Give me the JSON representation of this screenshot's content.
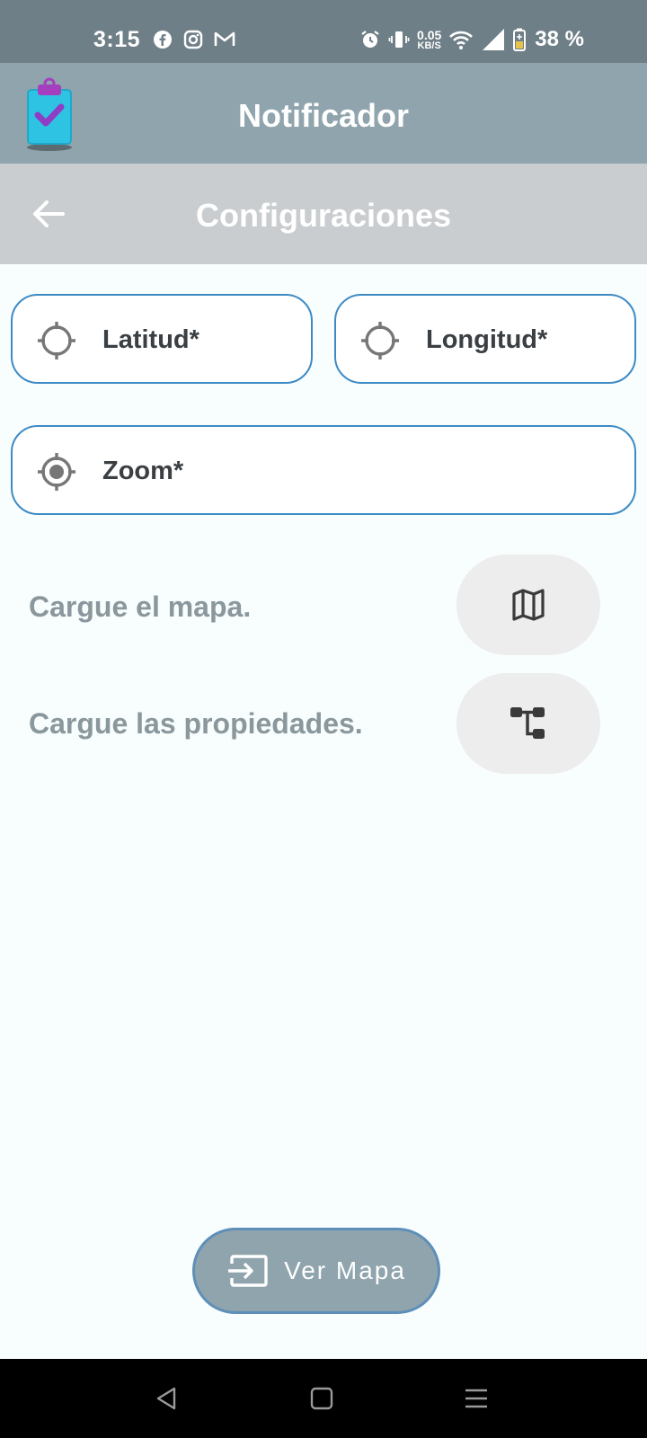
{
  "status_bar": {
    "time": "3:15",
    "speed_value": "0.05",
    "speed_unit": "KB/S",
    "battery_text": "38 %"
  },
  "app_bar": {
    "title": "Notificador",
    "logo_icon": "clipboard-check-icon"
  },
  "sub_bar": {
    "title": "Configuraciones",
    "back_icon": "arrow-left-icon"
  },
  "fields": {
    "latitude": {
      "label": "Latitud*",
      "icon": "crosshair-icon"
    },
    "longitude": {
      "label": "Longitud*",
      "icon": "crosshair-icon"
    },
    "zoom": {
      "label": "Zoom*",
      "icon": "gps-fixed-icon"
    }
  },
  "actions": {
    "load_map": {
      "text": "Cargue el mapa.",
      "icon": "map-icon"
    },
    "load_properties": {
      "text": "Cargue las propiedades.",
      "icon": "tree-structure-icon"
    }
  },
  "primary_button": {
    "label": "Ver Mapa",
    "icon": "input-arrow-icon"
  },
  "colors": {
    "status_bar": "#6f7f87",
    "app_bar": "#8fa4ad",
    "sub_bar": "#c9cdcf",
    "field_border": "#3d8bc4",
    "background": "#f8fdfe"
  }
}
